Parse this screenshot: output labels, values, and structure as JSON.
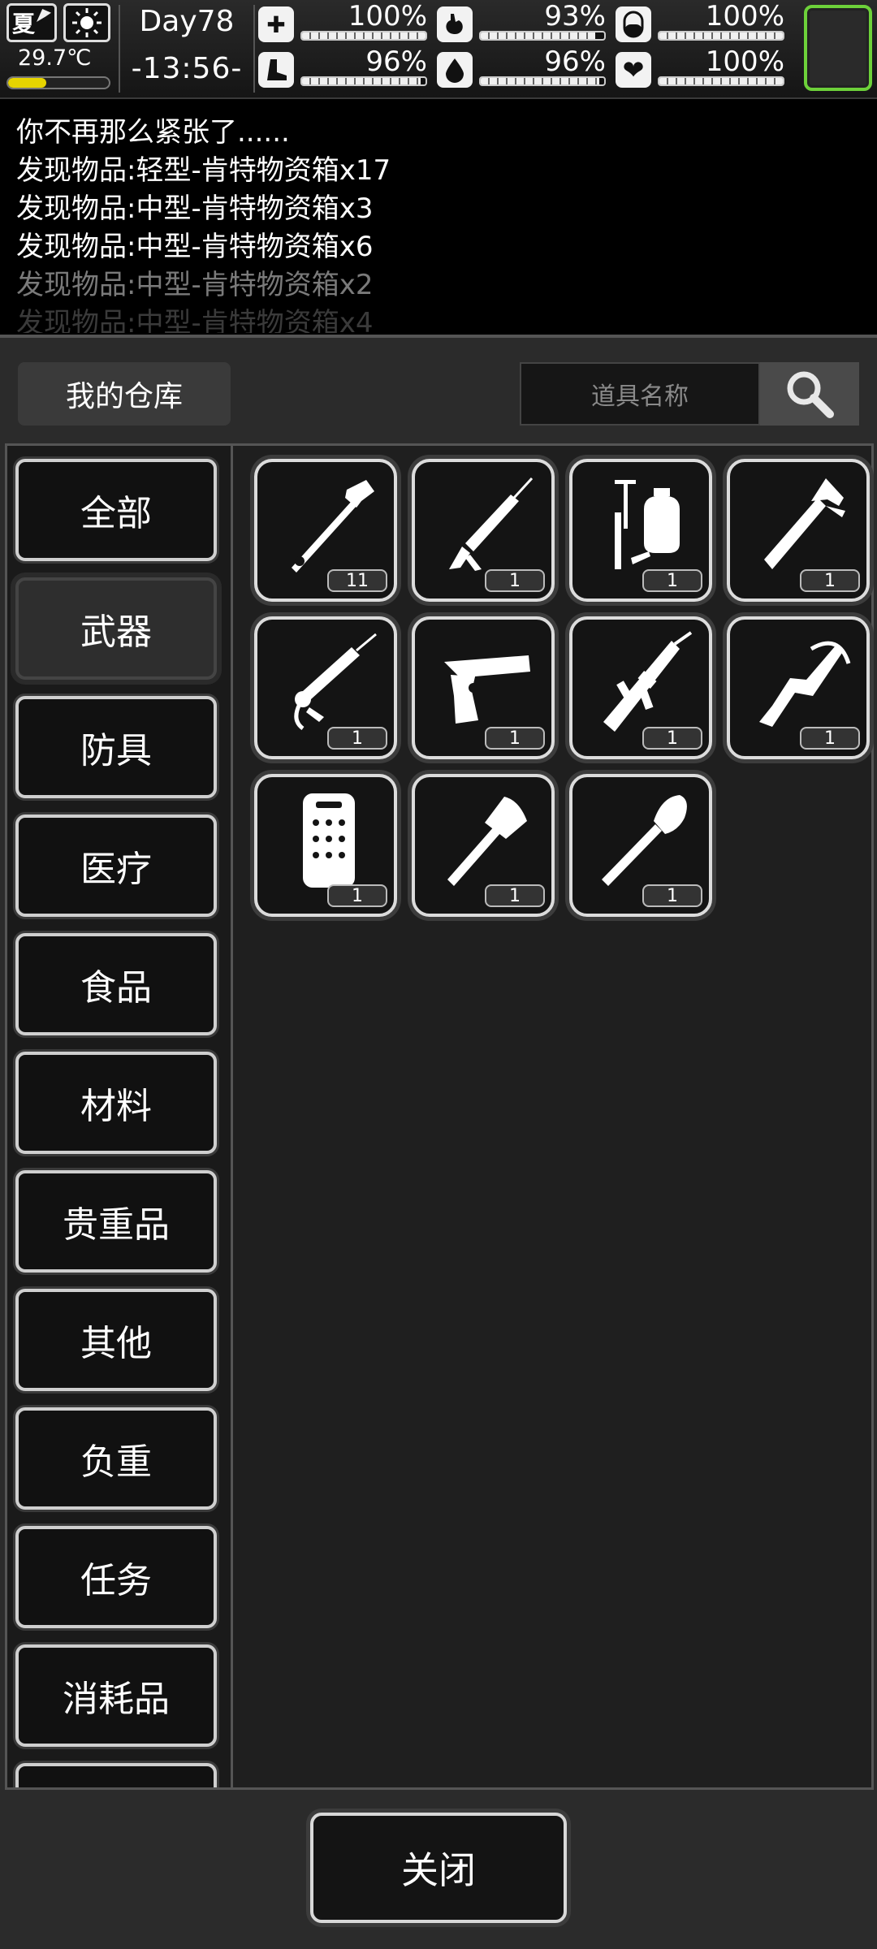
{
  "status": {
    "season": "夏",
    "weather_icon": "sun-icon",
    "temperature": "29.7℃",
    "temperature_level": 0.38,
    "day": "Day78",
    "time": "-13:56-",
    "stats": [
      {
        "name": "health",
        "icon": "medkit-icon",
        "value": "100%",
        "level": 1.0
      },
      {
        "name": "hunger",
        "icon": "stomach-icon",
        "value": "93%",
        "level": 0.93
      },
      {
        "name": "medicine",
        "icon": "pill-icon",
        "value": "100%",
        "level": 1.0
      },
      {
        "name": "stamina",
        "icon": "boot-icon",
        "value": "96%",
        "level": 0.96
      },
      {
        "name": "thirst",
        "icon": "water-drop-icon",
        "value": "96%",
        "level": 0.96
      },
      {
        "name": "mood",
        "icon": "heart-icon",
        "value": "100%",
        "level": 1.0
      }
    ]
  },
  "log": [
    "你不再那么紧张了......",
    "发现物品:轻型-肯特物资箱x17",
    "发现物品:中型-肯特物资箱x3",
    "发现物品:中型-肯特物资箱x6",
    "发现物品:中型-肯特物资箱x2",
    "发现物品:中型-肯特物资箱x4"
  ],
  "warehouse": {
    "title": "我的仓库",
    "search_placeholder": "道具名称",
    "search_icon": "search-icon",
    "categories": [
      "全部",
      "武器",
      "防具",
      "医疗",
      "食品",
      "材料",
      "贵重品",
      "其他",
      "负重",
      "任务",
      "消耗品",
      ""
    ],
    "active_category": "武器",
    "items": [
      {
        "icon": "pipe-wrench-icon",
        "qty": "11"
      },
      {
        "icon": "caulk-gun-icon",
        "qty": "1"
      },
      {
        "icon": "sprayer-icon",
        "qty": "1"
      },
      {
        "icon": "fire-axe-icon",
        "qty": "1"
      },
      {
        "icon": "grease-gun-icon",
        "qty": "1"
      },
      {
        "icon": "desert-eagle-pistol-icon",
        "qty": "1"
      },
      {
        "icon": "assault-rifle-icon",
        "qty": "1"
      },
      {
        "icon": "crossbow-icon",
        "qty": "1"
      },
      {
        "icon": "riot-shield-icon",
        "qty": "1"
      },
      {
        "icon": "hatchet-icon",
        "qty": "1"
      },
      {
        "icon": "shovel-icon",
        "qty": "1"
      }
    ],
    "close_label": "关闭"
  }
}
